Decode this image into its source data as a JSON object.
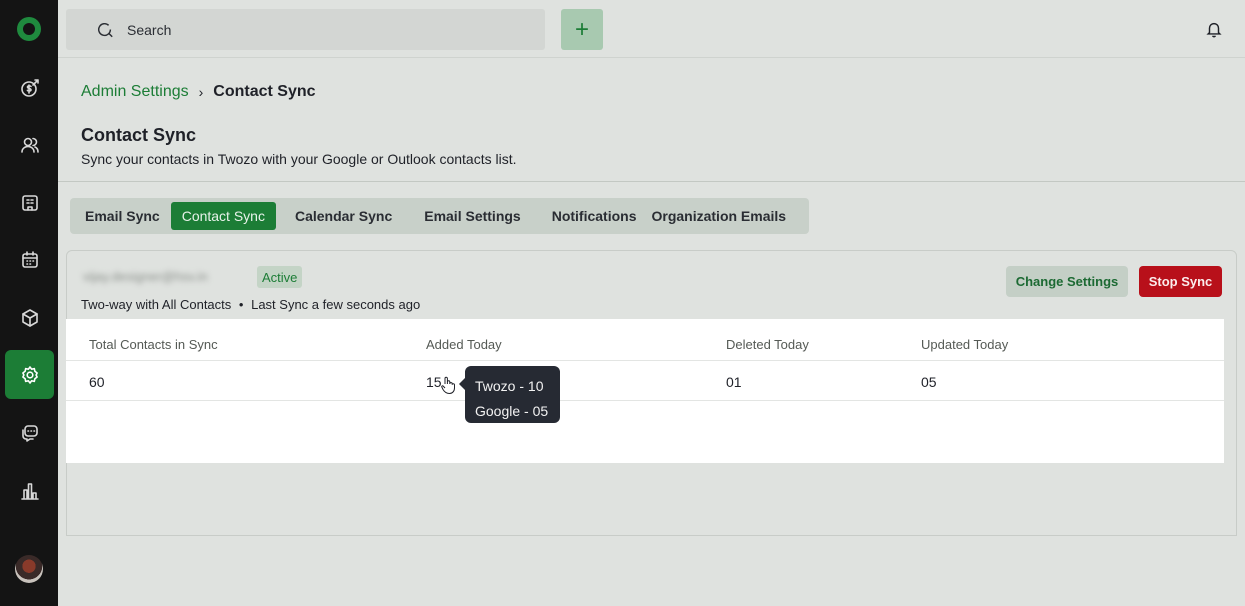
{
  "sidebar": {
    "logo_icon": "app-logo-icon",
    "items": [
      {
        "icon": "deals-icon",
        "active": false
      },
      {
        "icon": "contacts-icon",
        "active": false
      },
      {
        "icon": "companies-icon",
        "active": false
      },
      {
        "icon": "calendar-icon",
        "active": false
      },
      {
        "icon": "products-icon",
        "active": false
      },
      {
        "icon": "settings-icon",
        "active": true
      },
      {
        "icon": "conversations-icon",
        "active": false
      },
      {
        "icon": "reports-icon",
        "active": false
      }
    ]
  },
  "topbar": {
    "search_placeholder": "Search",
    "add_label": "+"
  },
  "breadcrumb": {
    "parent": "Admin Settings",
    "separator": "›",
    "current": "Contact Sync"
  },
  "page": {
    "title": "Contact Sync",
    "subtitle": "Sync your contacts in Twozo with your Google or Outlook contacts list."
  },
  "tabs": [
    {
      "label": "Email Sync",
      "active": false
    },
    {
      "label": "Contact Sync",
      "active": true
    },
    {
      "label": "Calendar Sync",
      "active": false
    },
    {
      "label": "Email Settings",
      "active": false
    },
    {
      "label": "Notifications",
      "active": false
    },
    {
      "label": "Organization Emails",
      "active": false
    }
  ],
  "account": {
    "email": "vijay.designer@hsv.in",
    "status": "Active",
    "sync_mode": "Two-way with All Contacts",
    "bullet": "•",
    "last_sync": "Last Sync a few seconds ago",
    "change_settings_label": "Change Settings",
    "stop_sync_label": "Stop Sync"
  },
  "table": {
    "headers": [
      "Total Contacts in Sync",
      "Added Today",
      "Deleted Today",
      "Updated Today"
    ],
    "row": [
      "60",
      "15",
      "01",
      "05"
    ]
  },
  "tooltip": {
    "lines": [
      "Twozo - 10",
      "Google - 05"
    ]
  },
  "colors": {
    "brand_green": "#1c7d36",
    "danger_red": "#b8101a",
    "sidebar_bg": "#141414",
    "tooltip_bg": "#262a33"
  }
}
